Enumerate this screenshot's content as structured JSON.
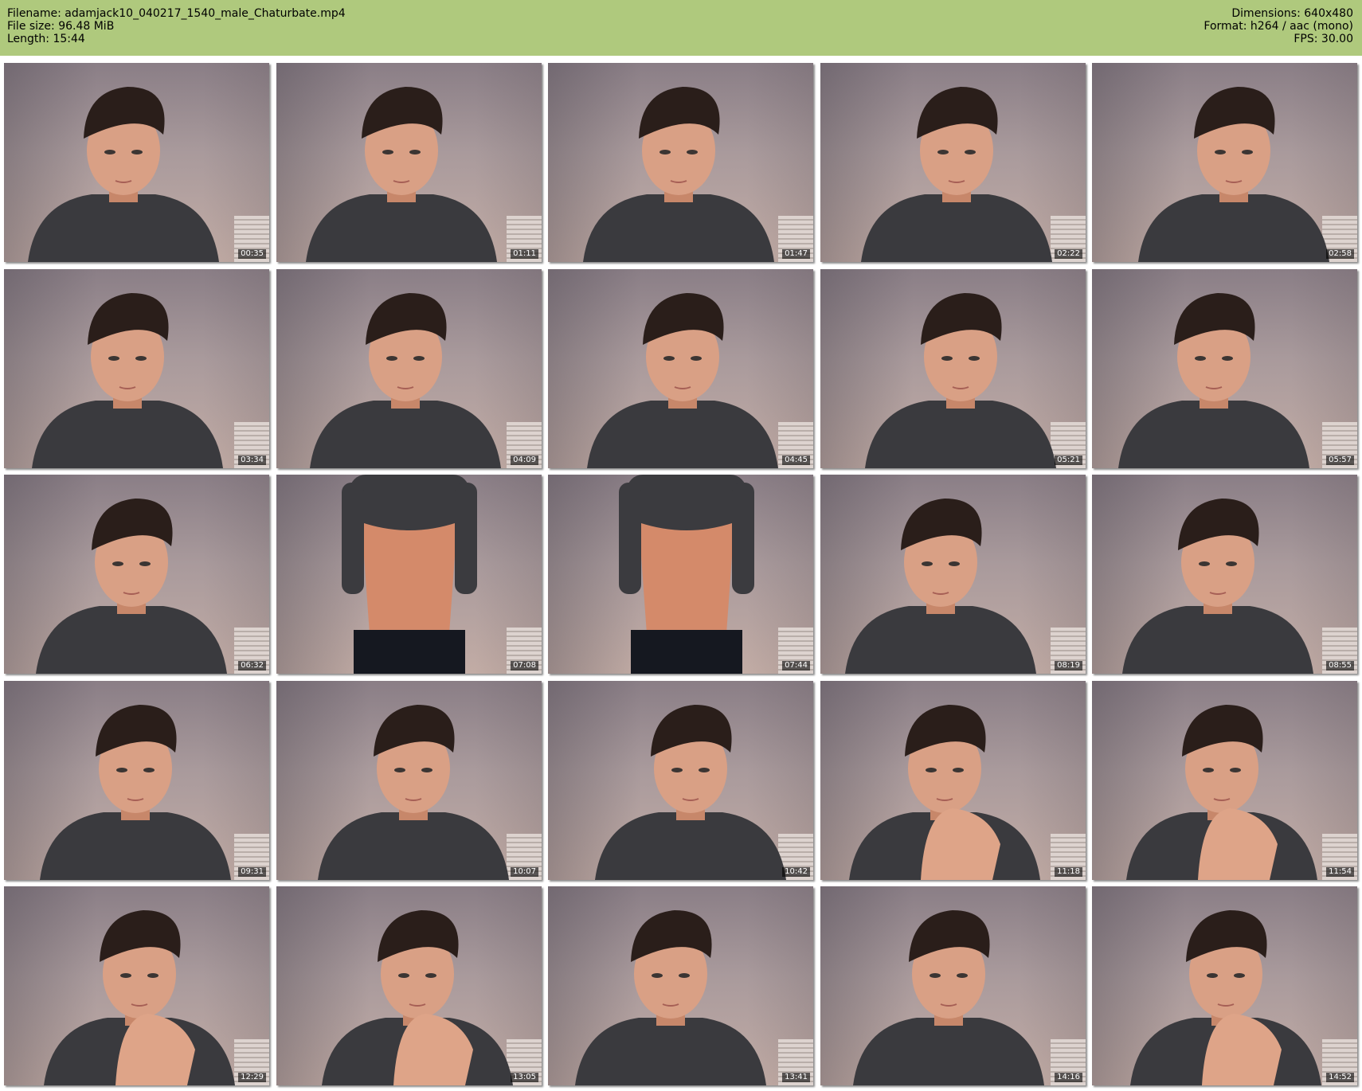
{
  "header": {
    "filename": "Filename: adamjack10_040217_1540_male_Chaturbate.mp4",
    "file_size": "File size: 96.48 MiB",
    "length": "Length: 15:44",
    "dimensions": "Dimensions: 640x480",
    "format": "Format: h264 / aac (mono)",
    "fps": "FPS: 30.00"
  },
  "colors": {
    "header_bg": "#afc97d",
    "page_bg": "#ffffff"
  },
  "thumbnails": [
    {
      "time": "00:35",
      "scene": "face"
    },
    {
      "time": "01:11",
      "scene": "face"
    },
    {
      "time": "01:47",
      "scene": "face"
    },
    {
      "time": "02:22",
      "scene": "face"
    },
    {
      "time": "02:58",
      "scene": "face"
    },
    {
      "time": "03:34",
      "scene": "face"
    },
    {
      "time": "04:09",
      "scene": "face"
    },
    {
      "time": "04:45",
      "scene": "face"
    },
    {
      "time": "05:21",
      "scene": "face"
    },
    {
      "time": "05:57",
      "scene": "face"
    },
    {
      "time": "06:32",
      "scene": "face"
    },
    {
      "time": "07:08",
      "scene": "torso"
    },
    {
      "time": "07:44",
      "scene": "torso"
    },
    {
      "time": "08:19",
      "scene": "face"
    },
    {
      "time": "08:55",
      "scene": "face"
    },
    {
      "time": "09:31",
      "scene": "face"
    },
    {
      "time": "10:07",
      "scene": "face"
    },
    {
      "time": "10:42",
      "scene": "face"
    },
    {
      "time": "11:18",
      "scene": "face-hand"
    },
    {
      "time": "11:54",
      "scene": "face-hand"
    },
    {
      "time": "12:29",
      "scene": "face-hand"
    },
    {
      "time": "13:05",
      "scene": "face-hand"
    },
    {
      "time": "13:41",
      "scene": "face"
    },
    {
      "time": "14:16",
      "scene": "face"
    },
    {
      "time": "14:52",
      "scene": "face-hand"
    }
  ]
}
